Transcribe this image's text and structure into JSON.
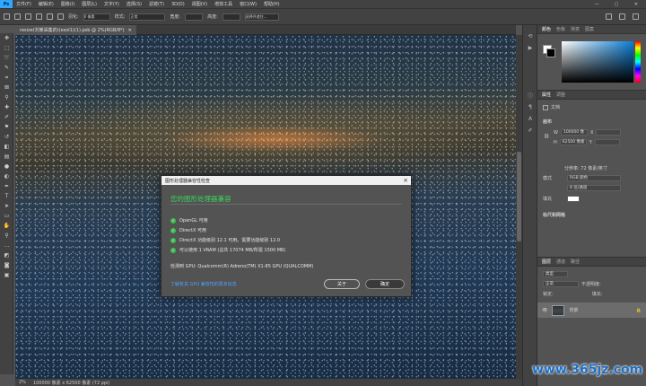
{
  "app": {
    "logo": "Ps"
  },
  "menubar": {
    "items": [
      "文件(F)",
      "编辑(E)",
      "图像(I)",
      "图层(L)",
      "文字(Y)",
      "选择(S)",
      "滤镜(T)",
      "3D(D)",
      "视图(V)",
      "增效工具",
      "窗口(W)",
      "帮助(H)"
    ],
    "window_controls": [
      "—",
      "▢",
      "✕"
    ]
  },
  "optionsbar": {
    "feather_label": "羽化:",
    "feather_value": "0 像素",
    "style_label": "样式:",
    "style_value": "正常",
    "width_label": "宽度:",
    "height_label": "高度:",
    "select_mask": "选择并遮住..."
  },
  "document": {
    "tab_title": "resize(刘某采集的)(esol1)(1).psb @ 2%(RGB/8*)",
    "close": "✕"
  },
  "statusbar": {
    "zoom": "2%",
    "info": "100000 像素 x 62500 像素 (72 ppi)"
  },
  "color_panel": {
    "tabs": [
      "颜色",
      "色板",
      "渐变",
      "图案"
    ]
  },
  "properties_panel": {
    "tabs": [
      "属性",
      "调整"
    ],
    "doc_label": "文档",
    "canvas_header": "画布",
    "w_label": "W",
    "w_value": "100000 像",
    "x_label": "X",
    "h_label": "H",
    "h_value": "62500 像素",
    "y_label": "Y",
    "resolution": "分辨率: 72 像素/英寸",
    "mode_label": "模式",
    "mode_value": "RGB 颜色",
    "depth_value": "8 位/通道",
    "fill_label": "填充",
    "rulers_header": "标尺和网格"
  },
  "layers_panel": {
    "tabs": [
      "图层",
      "通道",
      "路径"
    ],
    "kind_label": "类型",
    "blend_mode": "正常",
    "opacity_label": "不透明度:",
    "lock_label": "锁定:",
    "fill_label": "填充:",
    "layer_name": "背景"
  },
  "dialog": {
    "title": "图形处理器兼容性检查",
    "heading": "您的图形处理器兼容",
    "checks": [
      "OpenGL 可用",
      "DirectX 可用",
      "DirectX 功能级别 12.1 可用。需要功能级别 12.0",
      "可以使用 1 VRAM (总共 17074 MB/所需 1500 MB)"
    ],
    "gpu_info": "检测到 GPU: Qualcomm(R) Adreno(TM) X1-85 GPU (QUALCOMM)",
    "link": "了解有关 GPU 兼容性的更多信息",
    "about_button": "关于",
    "ok_button": "确定"
  },
  "watermark": {
    "text": "www.365jz.com"
  },
  "colors": {
    "accent": "#31a8ff",
    "success": "#3fbf52",
    "link": "#4aa5ff",
    "watermark": "#1e6fc4"
  }
}
